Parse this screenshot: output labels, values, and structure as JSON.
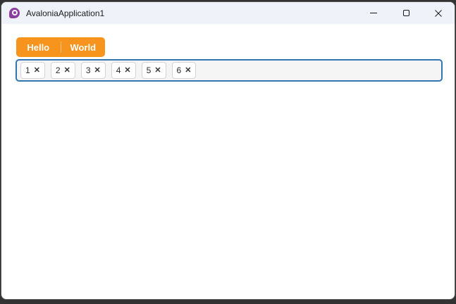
{
  "window": {
    "title": "AvaloniaApplication1"
  },
  "tabs": [
    {
      "label": "Hello"
    },
    {
      "label": "World"
    }
  ],
  "chips": {
    "remove_glyph": "✕",
    "items": [
      {
        "label": "1"
      },
      {
        "label": "2"
      },
      {
        "label": "3"
      },
      {
        "label": "4"
      },
      {
        "label": "5"
      },
      {
        "label": "6"
      }
    ]
  },
  "icons": {
    "app_logo": "avalonia-logo",
    "minimize": "minimize-line",
    "maximize": "maximize-square",
    "close": "close-x"
  },
  "colors": {
    "accent_orange": "#F7941E",
    "focus_border_blue": "#3276B1",
    "logo_purple": "#8B3F9E",
    "titlebar_bg": "#EFF3F9",
    "desktop_bg": "#333333"
  }
}
